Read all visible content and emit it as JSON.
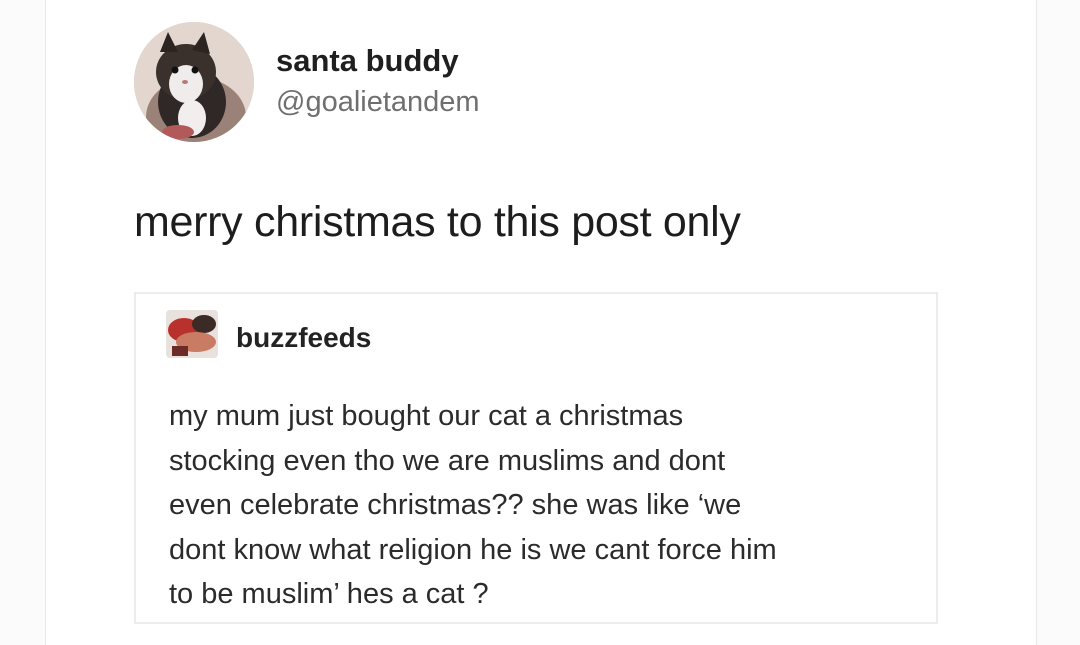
{
  "post": {
    "user": {
      "name": "santa buddy",
      "handle": "@goalietandem",
      "avatar_icon": "cat-avatar-icon"
    },
    "text": "merry christmas to this post only"
  },
  "quoted_post": {
    "user": {
      "name": "buzzfeeds",
      "avatar_icon": "user-avatar-icon"
    },
    "lines": [
      "my mum just bought our cat a christmas",
      "stocking even tho we are muslims and dont",
      "even celebrate christmas?? she was like ‘we",
      "dont know what religion he is we cant force him",
      "to be muslim’ hes a cat ?"
    ]
  },
  "colors": {
    "background": "#fbfbfb",
    "card": "#ffffff",
    "text_primary": "#1d1d1d",
    "text_secondary": "#6f6f6f",
    "border": "#ececec"
  }
}
